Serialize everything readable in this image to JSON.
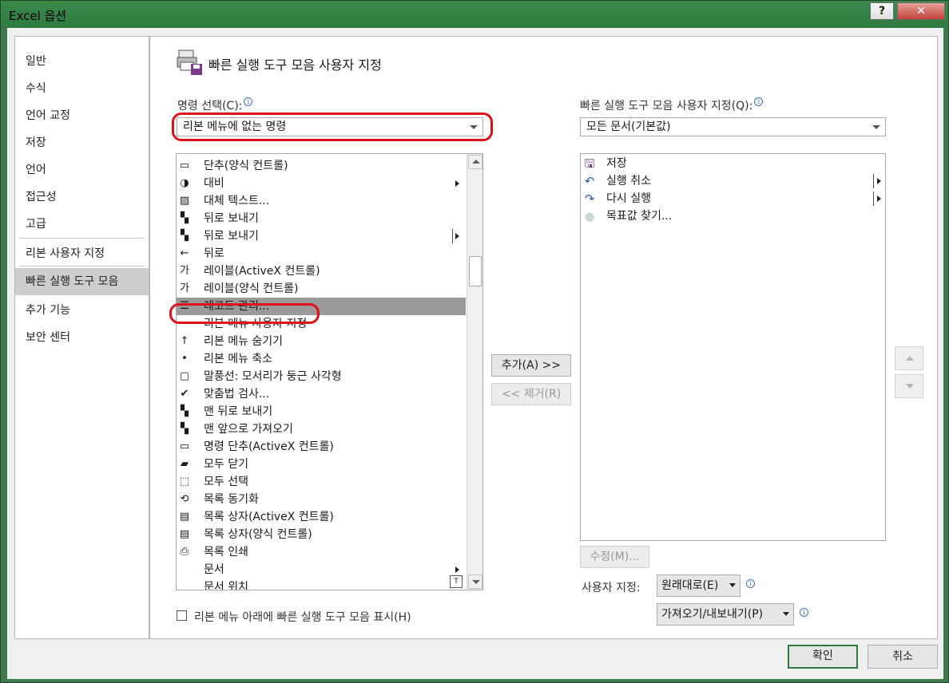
{
  "window": {
    "title": "Excel 옵션",
    "help_label": "?",
    "close_label": "✕"
  },
  "sidebar": {
    "items": [
      {
        "label": "일반"
      },
      {
        "label": "수식"
      },
      {
        "label": "언어 교정"
      },
      {
        "label": "저장"
      },
      {
        "label": "언어"
      },
      {
        "label": "접근성"
      },
      {
        "label": "고급"
      },
      {
        "label": "리본 사용자 지정"
      },
      {
        "label": "빠른 실행 도구 모음",
        "active": true
      },
      {
        "label": "추가 기능"
      },
      {
        "label": "보안 센터"
      }
    ]
  },
  "header": {
    "title": "빠른 실행 도구 모음 사용자 지정",
    "icon": "print-save-icon"
  },
  "commands": {
    "label": "명령 선택(C):",
    "selected": "리본 메뉴에 없는 명령",
    "items": [
      {
        "label": "단추(양식 컨트롤)",
        "icon": "button-icon",
        "glyph": "▭"
      },
      {
        "label": "대비",
        "icon": "contrast-icon",
        "glyph": "◑",
        "submenu": true
      },
      {
        "label": "대체 텍스트...",
        "icon": "alt-text-icon",
        "glyph": "▨"
      },
      {
        "label": "뒤로 보내기",
        "icon": "send-backward-icon",
        "glyph": "▚"
      },
      {
        "label": "뒤로 보내기",
        "icon": "send-backward-icon",
        "glyph": "▚",
        "submenu": true,
        "bar": true
      },
      {
        "label": "뒤로",
        "icon": "back-arrow-icon",
        "glyph": "←"
      },
      {
        "label": "레이블(ActiveX 컨트롤)",
        "icon": "label-icon",
        "glyph": "가"
      },
      {
        "label": "레이블(양식 컨트롤)",
        "icon": "label-form-icon",
        "glyph": "가"
      },
      {
        "label": "레코드 관리...",
        "icon": "form-icon",
        "glyph": "☰",
        "selected": true
      },
      {
        "label": "리본 메뉴 사용자 지정",
        "icon": "",
        "glyph": ""
      },
      {
        "label": "리본 메뉴 숨기기",
        "icon": "ribbon-hide-icon",
        "glyph": "↑"
      },
      {
        "label": "리본 메뉴 축소",
        "icon": "ribbon-collapse-icon",
        "glyph": "•"
      },
      {
        "label": "말풍선: 모서리가 둥근 사각형",
        "icon": "callout-icon",
        "glyph": "▢"
      },
      {
        "label": "맞춤법 검사...",
        "icon": "spelling-icon",
        "glyph": "✔"
      },
      {
        "label": "맨 뒤로 보내기",
        "icon": "send-to-back-icon",
        "glyph": "▚"
      },
      {
        "label": "맨 앞으로 가져오기",
        "icon": "bring-to-front-icon",
        "glyph": "▚"
      },
      {
        "label": "명령 단추(ActiveX 컨트롤)",
        "icon": "command-button-icon",
        "glyph": "▭"
      },
      {
        "label": "모두 닫기",
        "icon": "close-all-icon",
        "glyph": "▰"
      },
      {
        "label": "모두 선택",
        "icon": "select-all-icon",
        "glyph": "⬚"
      },
      {
        "label": "목록 동기화",
        "icon": "sync-list-icon",
        "glyph": "⟲"
      },
      {
        "label": "목록 상자(ActiveX 컨트롤)",
        "icon": "list-box-icon",
        "glyph": "▤"
      },
      {
        "label": "목록 상자(양식 컨트롤)",
        "icon": "list-box-form-icon",
        "glyph": "▤"
      },
      {
        "label": "목록 인쇄",
        "icon": "print-list-icon",
        "glyph": "⎙"
      },
      {
        "label": "문서",
        "icon": "",
        "glyph": "",
        "submenu": true
      },
      {
        "label": "문서 위치",
        "icon": "",
        "glyph": ""
      }
    ]
  },
  "qat": {
    "label": "빠른 실행 도구 모음 사용자 지정(Q):",
    "selected": "모든 문서(기본값)",
    "items": [
      {
        "label": "저장",
        "icon": "save-icon",
        "glyph": "🖫",
        "color": "#7a3a8c"
      },
      {
        "label": "실행 취소",
        "icon": "undo-icon",
        "glyph": "↶",
        "color": "#2a5fa8",
        "submenu": true
      },
      {
        "label": "다시 실행",
        "icon": "redo-icon",
        "glyph": "↷",
        "color": "#2a5fa8",
        "submenu": true
      },
      {
        "label": "목표값 찾기...",
        "icon": "goal-seek-icon",
        "glyph": "●",
        "color": "#c9d9cf"
      }
    ]
  },
  "buttons": {
    "add": "추가(A) >>",
    "remove": "<< 제거(R)",
    "modify": "수정(M)...",
    "reset": "원래대로(E)",
    "import_export": "가져오기/내보내기(P)",
    "ok": "확인",
    "cancel": "취소"
  },
  "customize_label": "사용자 지정:",
  "show_below_ribbon": "리본 메뉴 아래에 빠른 실행 도구 모음 표시(H)",
  "colors": {
    "title_bar": "#2f7a40",
    "highlight": "#e0101a",
    "selected_row": "#9a9a9a"
  }
}
